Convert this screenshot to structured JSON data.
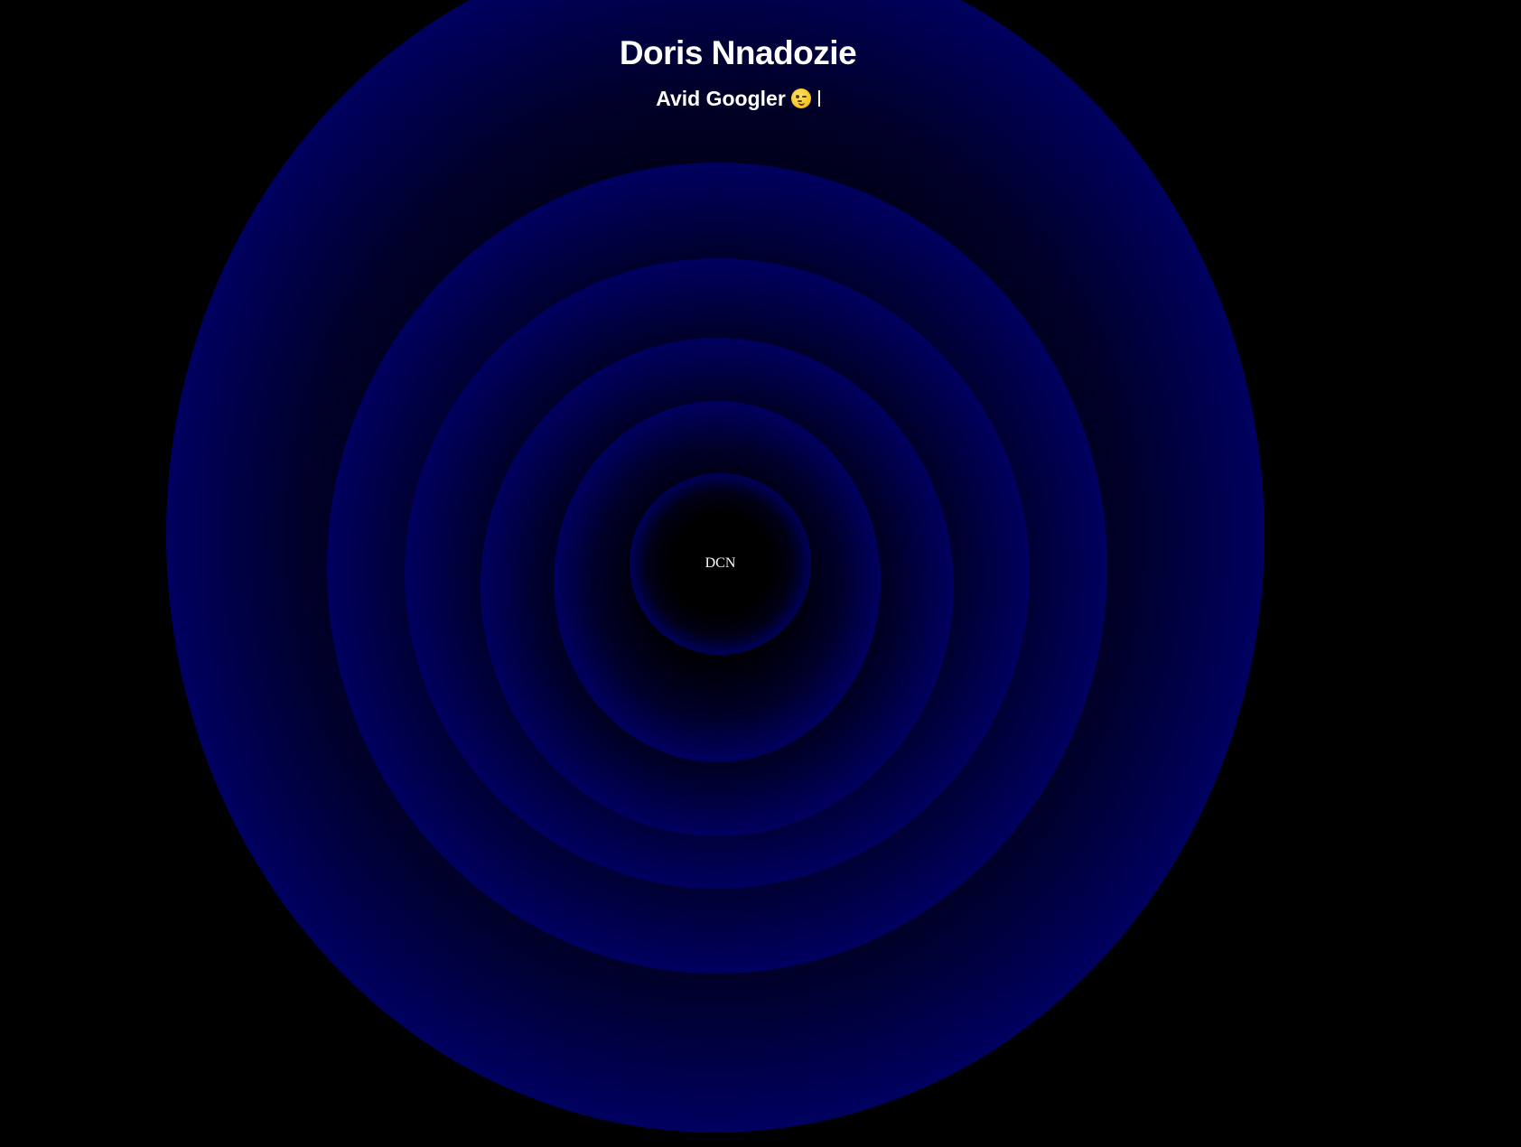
{
  "header": {
    "name": "Doris Nnadozie",
    "tagline": "Avid Googler",
    "tagline_icon": "winking-face-icon"
  },
  "center": {
    "monogram": "DCN"
  },
  "colors": {
    "background": "#000000",
    "ring_edge": "#000060",
    "text": "#ffffff"
  }
}
